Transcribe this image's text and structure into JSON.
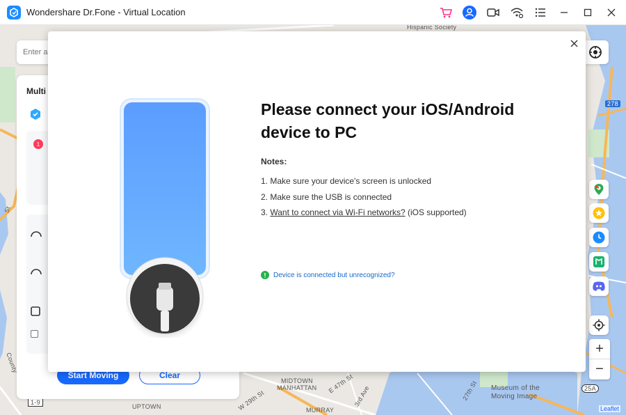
{
  "window": {
    "title": "Wondershare Dr.Fone - Virtual Location"
  },
  "map": {
    "labels": {
      "hispanic_society": "Hispanic Society",
      "midtown": "MIDTOWN",
      "manhattan": "MANHATTAN",
      "uptown": "UPTOWN",
      "murray": "MURRAY",
      "museum_line1": "Museum of the",
      "museum_line2": "Moving Image",
      "e47": "E 47th St",
      "w29": "W 29th St",
      "third_ave": "3rd Ave",
      "twentyseventh": "27th St",
      "county": "County",
      "st": "St",
      "route_278": "278",
      "route_25a": "25A",
      "route_i9": "1-9"
    },
    "attribution": "Leaflet",
    "search_placeholder": "Enter a"
  },
  "side_panel": {
    "title": "Multi",
    "badge": "1",
    "start_button": "Start Moving",
    "clear_button": "Clear"
  },
  "dialog": {
    "title": "Please connect your iOS/Android device to PC",
    "notes_heading": "Notes:",
    "note1": "1. Make sure your device's screen is unlocked",
    "note2": "2. Make sure the USB is connected",
    "note3_prefix": "3. ",
    "note3_link": "Want to connect via Wi-Fi networks?",
    "note3_suffix": " (iOS supported)",
    "status_link": "Device is connected but unrecognized?"
  },
  "colors": {
    "accent": "#1769ff",
    "phone_top": "#5b9dff",
    "phone_bottom": "#6fb6ff",
    "status_green": "#26b34a"
  }
}
